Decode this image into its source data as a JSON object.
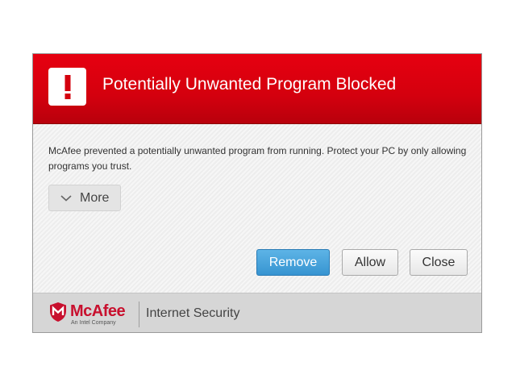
{
  "header": {
    "title": "Potentially Unwanted Program Blocked",
    "alert_icon": "exclamation-icon",
    "color": "#d4000e"
  },
  "body": {
    "message": "McAfee prevented a potentially unwanted program from running. Protect your PC by only allowing programs you trust.",
    "more_label": "More",
    "more_icon": "chevron-down-icon"
  },
  "buttons": {
    "remove_label": "Remove",
    "allow_label": "Allow",
    "close_label": "Close",
    "primary_color": "#3794d1"
  },
  "footer": {
    "brand": "McAfee",
    "tagline": "An Intel Company",
    "product": "Internet Security",
    "brand_color": "#c8102e"
  }
}
